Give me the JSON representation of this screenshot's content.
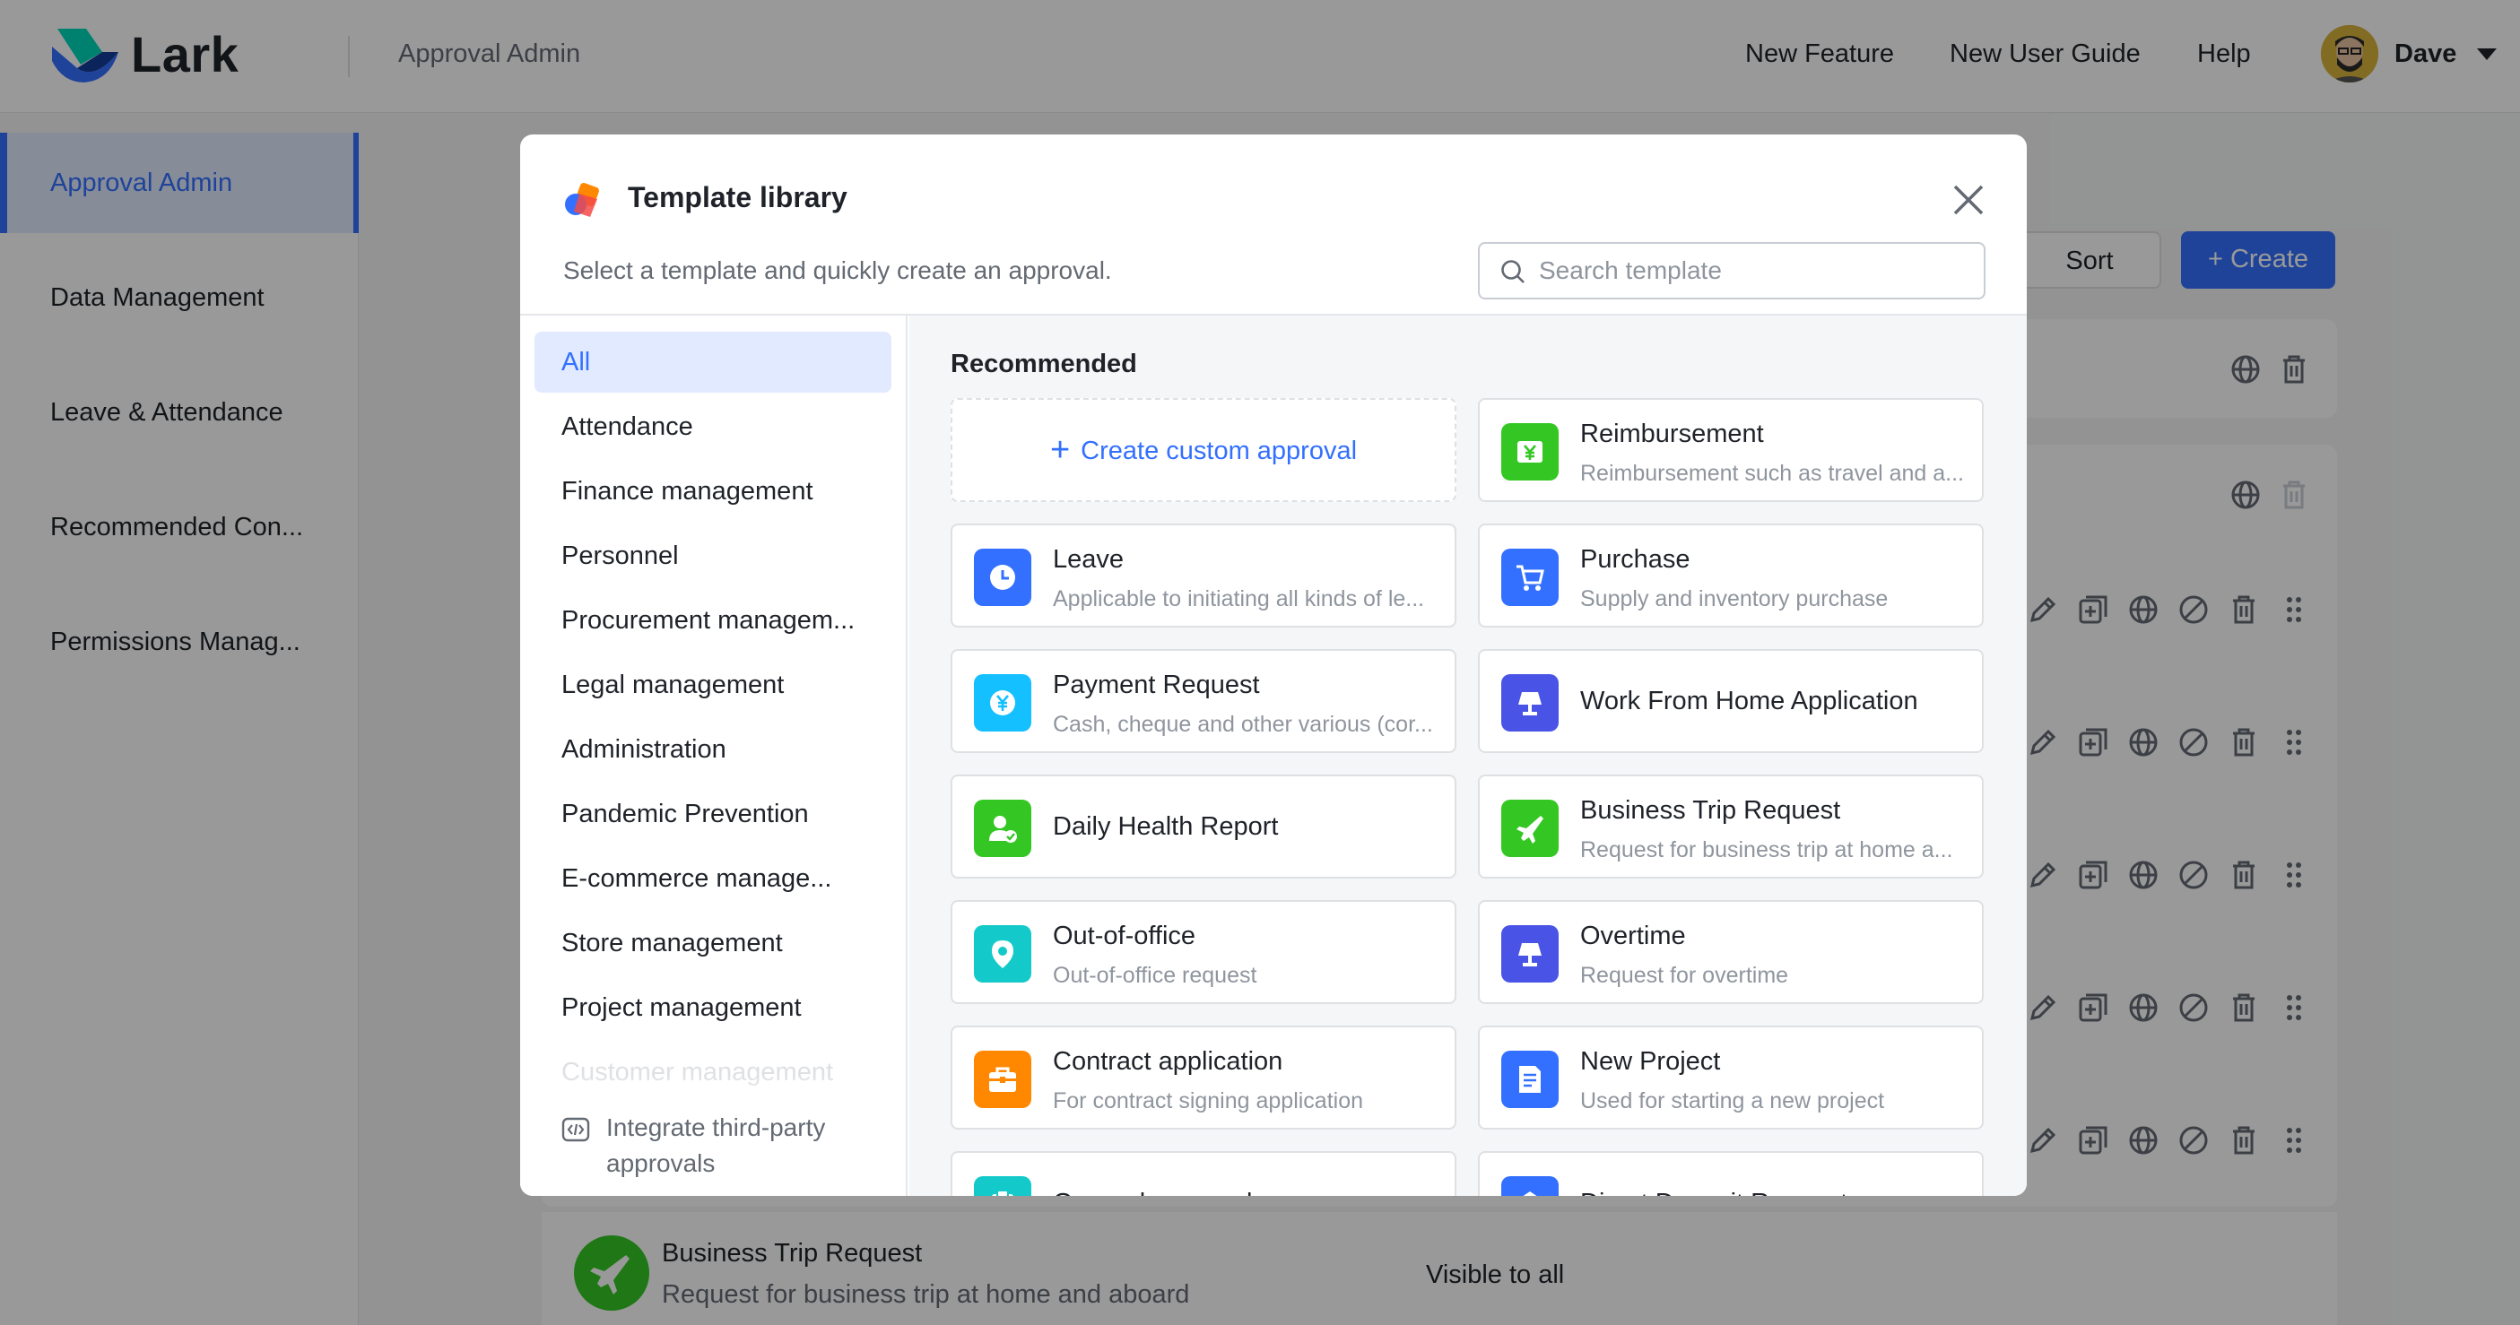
{
  "header": {
    "logo_text": "Lark",
    "app_title": "Approval Admin",
    "nav": [
      "New Feature",
      "New User Guide",
      "Help"
    ],
    "user_name": "Dave"
  },
  "sidebar": {
    "items": [
      {
        "label": "Approval Admin",
        "active": true
      },
      {
        "label": "Data Management"
      },
      {
        "label": "Leave & Attendance"
      },
      {
        "label": "Recommended Con..."
      },
      {
        "label": "Permissions Manag..."
      }
    ]
  },
  "toolbar": {
    "sort_label": "Sort",
    "create_label": "+ Create"
  },
  "bg_list": {
    "last_item": {
      "title": "Business Trip Request",
      "desc": "Request for business trip at home and aboard",
      "visibility": "Visible to all"
    }
  },
  "modal": {
    "title": "Template library",
    "subtitle": "Select a template and quickly create an approval.",
    "search_placeholder": "Search template",
    "categories": [
      {
        "label": "All",
        "active": true
      },
      {
        "label": "Attendance"
      },
      {
        "label": "Finance management"
      },
      {
        "label": "Personnel"
      },
      {
        "label": "Procurement managem..."
      },
      {
        "label": "Legal management"
      },
      {
        "label": "Administration"
      },
      {
        "label": "Pandemic Prevention"
      },
      {
        "label": "E-commerce manage..."
      },
      {
        "label": "Store management"
      },
      {
        "label": "Project management"
      },
      {
        "label": "Customer management"
      }
    ],
    "integrate_label": "Integrate third-party approvals",
    "section_title": "Recommended",
    "custom_label": "Create custom approval",
    "cards": [
      {
        "title": "Reimbursement",
        "desc": "Reimbursement such as travel and a...",
        "icon": "yen-note-icon",
        "color": "#34c724"
      },
      {
        "title": "Leave",
        "desc": "Applicable to initiating all kinds of le...",
        "icon": "clock-icon",
        "color": "#3370ff"
      },
      {
        "title": "Purchase",
        "desc": "Supply and inventory purchase",
        "icon": "cart-icon",
        "color": "#3370ff"
      },
      {
        "title": "Payment Request",
        "desc": "Cash, cheque and other various (cor...",
        "icon": "yen-coin-icon",
        "color": "#14c0ff"
      },
      {
        "title": "Work From Home Application",
        "desc": "",
        "icon": "lamp-icon",
        "color": "#4954e6"
      },
      {
        "title": "Daily Health Report",
        "desc": "",
        "icon": "health-user-icon",
        "color": "#34c724"
      },
      {
        "title": "Business Trip Request",
        "desc": "Request for business trip at home a...",
        "icon": "airplane-icon",
        "color": "#34c724"
      },
      {
        "title": "Out-of-office",
        "desc": "Out-of-office request",
        "icon": "location-pin-icon",
        "color": "#14c9c9"
      },
      {
        "title": "Overtime",
        "desc": "Request for overtime",
        "icon": "lamp-icon",
        "color": "#4954e6"
      },
      {
        "title": "Contract application",
        "desc": "For contract signing application",
        "icon": "briefcase-icon",
        "color": "#ff8800"
      },
      {
        "title": "New Project",
        "desc": "Used for starting a new project",
        "icon": "document-icon",
        "color": "#3370ff"
      },
      {
        "title": "General approval",
        "desc": "",
        "icon": "clipboard-icon",
        "color": "#14c9c9"
      },
      {
        "title": "Direct Deposit Request",
        "desc": "",
        "icon": "bank-icon",
        "color": "#3370ff"
      }
    ]
  }
}
